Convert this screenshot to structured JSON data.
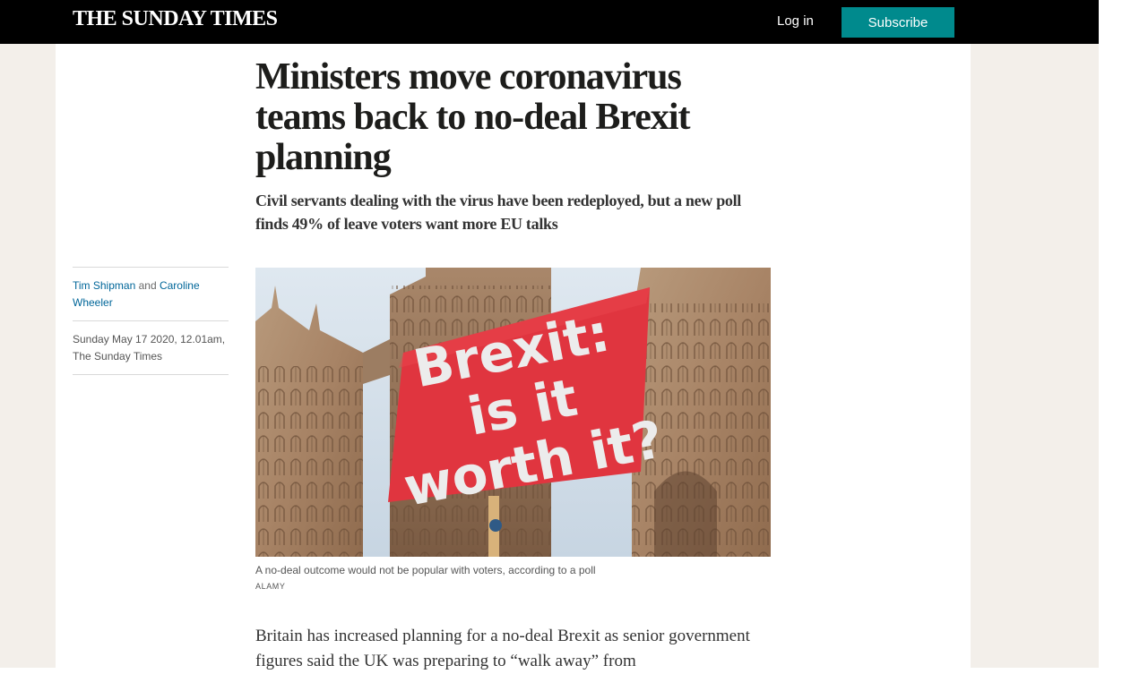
{
  "header": {
    "masthead": "THE SUNDAY TIMES",
    "login_label": "Log in",
    "subscribe_label": "Subscribe"
  },
  "article": {
    "headline": "Ministers move coronavirus teams back to no-deal Brexit planning",
    "standfirst": "Civil servants dealing with the virus have been redeployed, but a new poll finds 49% of leave voters want more EU talks",
    "authors": [
      {
        "name": "Tim Shipman"
      },
      {
        "name": "Caroline Wheeler"
      }
    ],
    "author_separator": "and",
    "dateline": "Sunday May 17 2020, 12.01am, The Sunday Times",
    "image": {
      "sign_text": [
        "Brexit:",
        "is it",
        "worth it?"
      ],
      "caption": "A no-deal outcome would not be popular with voters, according to a poll",
      "credit": "ALAMY"
    },
    "body_first_paragraph": "Britain has increased planning for a no-deal Brexit as senior government figures said the UK was preparing to “walk away” from"
  },
  "colors": {
    "topbar": "#000000",
    "subscribe": "#008a8d",
    "page_background": "#f3efea",
    "author_link": "#006699"
  }
}
